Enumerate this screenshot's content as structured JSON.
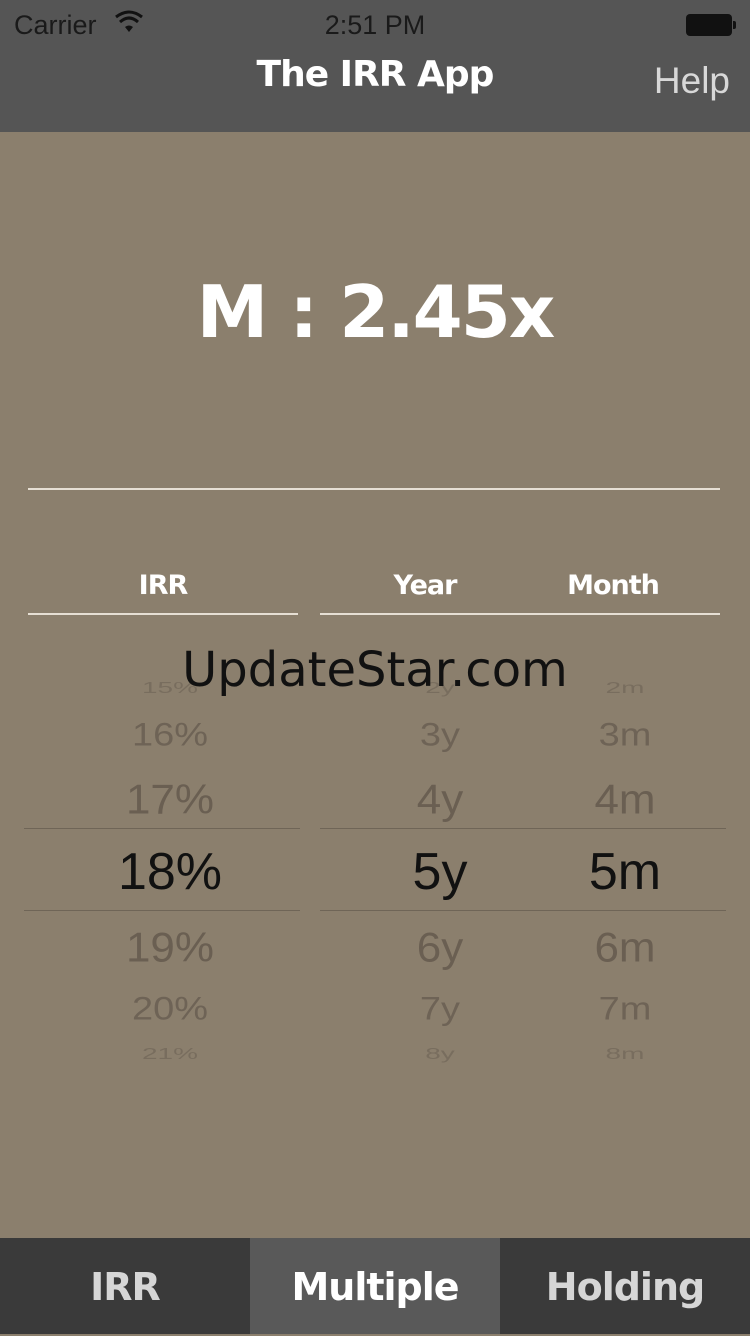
{
  "status_bar": {
    "carrier": "Carrier",
    "time": "2:51 PM"
  },
  "nav": {
    "title": "The IRR App",
    "help": "Help"
  },
  "result": "M : 2.45x",
  "columns": {
    "irr": "IRR",
    "year": "Year",
    "month": "Month"
  },
  "pickers": {
    "irr": {
      "items": [
        "15%",
        "16%",
        "17%",
        "18%",
        "19%",
        "20%",
        "21%"
      ],
      "selected": "18%"
    },
    "year": {
      "items": [
        "2y",
        "3y",
        "4y",
        "5y",
        "6y",
        "7y",
        "8y"
      ],
      "selected": "5y"
    },
    "month": {
      "items": [
        "2m",
        "3m",
        "4m",
        "5m",
        "6m",
        "7m",
        "8m"
      ],
      "selected": "5m"
    }
  },
  "watermark": "UpdateStar.com",
  "tabs": [
    {
      "label": "IRR",
      "active": false
    },
    {
      "label": "Multiple",
      "active": true
    },
    {
      "label": "Holding",
      "active": false
    }
  ],
  "colors": {
    "background": "#8b7f6d",
    "bars": "#555555",
    "tab_bar": "#3a3a3a",
    "tab_active": "#595959"
  }
}
